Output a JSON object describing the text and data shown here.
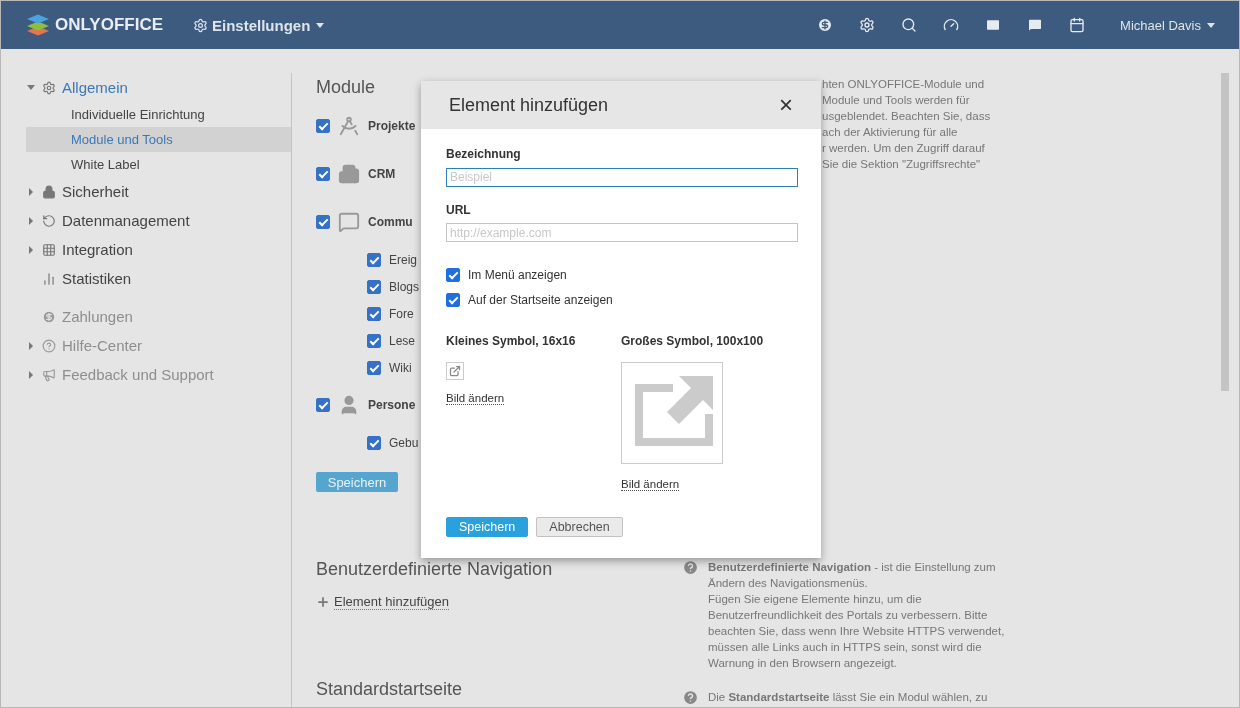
{
  "header": {
    "logo": "ONLYOFFICE",
    "menu": "Einstellungen",
    "user": "Michael Davis"
  },
  "sidebar": {
    "main": [
      {
        "label": "Allgemein",
        "kind": "group",
        "expanded": true,
        "children": [
          {
            "label": "Individuelle Einrichtung",
            "selected": false
          },
          {
            "label": "Module und Tools",
            "selected": true
          },
          {
            "label": "White Label",
            "selected": false
          }
        ]
      },
      {
        "label": "Sicherheit",
        "kind": "group",
        "expanded": false
      },
      {
        "label": "Datenmanagement",
        "kind": "group",
        "expanded": false
      },
      {
        "label": "Integration",
        "kind": "group",
        "expanded": false
      },
      {
        "label": "Statistiken",
        "kind": "leaf"
      }
    ],
    "extra": [
      {
        "label": "Zahlungen",
        "kind": "leaf"
      },
      {
        "label": "Hilfe-Center",
        "kind": "group",
        "expanded": false
      },
      {
        "label": "Feedback und Support",
        "kind": "group",
        "expanded": false
      }
    ]
  },
  "modules": {
    "title": "Module",
    "items": [
      {
        "label": "Projekte",
        "checked": true
      },
      {
        "label": "CRM",
        "checked": true
      },
      {
        "label": "Commu",
        "checked": true,
        "children": [
          {
            "label": "Ereig",
            "checked": true
          },
          {
            "label": "Blogs",
            "checked": true
          },
          {
            "label": "Fore",
            "checked": true
          },
          {
            "label": "Lese",
            "checked": true
          },
          {
            "label": "Wiki",
            "checked": true
          }
        ]
      },
      {
        "label": "Persone",
        "checked": true,
        "children": [
          {
            "label": "Gebu",
            "checked": true
          }
        ]
      }
    ],
    "save": "Speichern",
    "help_lines": [
      "hten ONLYOFFICE-Module und",
      "Module und Tools werden für",
      "usgeblendet. Beachten Sie, dass",
      "ach der Aktivierung für alle",
      "r werden. Um den Zugriff darauf",
      "Sie die Sektion \"Zugriffsrechte\""
    ]
  },
  "navigation": {
    "title": "Benutzerdefinierte Navigation",
    "add": "Element hinzufügen",
    "help": [
      "**Benutzerdefinierte Navigation** - ist die Einstellung zum Ändern des Navigationsmenüs.",
      "Fügen Sie eigene Elemente hinzu, um die Benutzerfreundlichkeit des Portals zu verbessern. Bitte beachten Sie, dass wenn Ihre Website HTTPS verwendet, müssen alle Links auch in HTTPS sein, sonst wird die Warnung in den Browsern angezeigt."
    ]
  },
  "start_page": {
    "title": "Standardstartseite",
    "help": [
      "Die **Standardstartseite** lässt Sie ein Modul wählen, zu"
    ]
  },
  "dialog": {
    "title": "Element hinzufügen",
    "close": "×",
    "fields": [
      {
        "label": "Bezeichnung",
        "placeholder": "Beispiel",
        "focused": true
      },
      {
        "label": "URL",
        "placeholder": "http://example.com",
        "focused": false
      }
    ],
    "options": [
      {
        "label": "Im Menü anzeigen",
        "checked": true
      },
      {
        "label": "Auf der Startseite anzeigen",
        "checked": true
      }
    ],
    "small_icon": {
      "title": "Kleines Symbol, 16x16",
      "link": "Bild ändern"
    },
    "large_icon": {
      "title": "Großes Symbol, 100x100",
      "link": "Bild ändern"
    },
    "buttons": [
      {
        "label": "Speichern",
        "kind": "primary"
      },
      {
        "label": "Abbrechen",
        "kind": "secondary"
      }
    ]
  }
}
